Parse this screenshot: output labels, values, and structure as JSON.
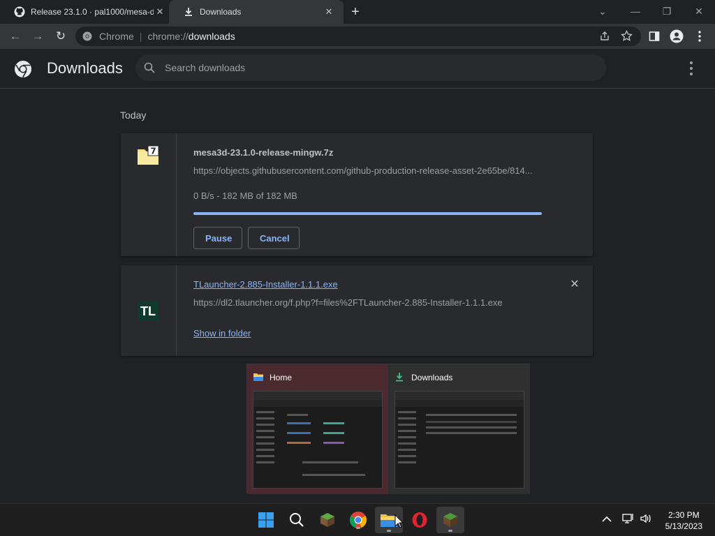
{
  "tabs": [
    {
      "title": "Release 23.1.0 · pal1000/mesa-di",
      "close": "✕"
    },
    {
      "title": "Downloads",
      "close": "✕"
    }
  ],
  "new_tab": "+",
  "window_controls": {
    "minimize": "—",
    "restore": "❐",
    "close": "✕",
    "dropdown": "⌄"
  },
  "toolbar": {
    "back": "←",
    "forward": "→",
    "reload": "↻",
    "site_label": "Chrome",
    "url_scheme": "chrome://",
    "url_host": "downloads"
  },
  "header": {
    "title": "Downloads",
    "search_placeholder": "Search downloads"
  },
  "section_label": "Today",
  "downloads": [
    {
      "filename": "mesa3d-23.1.0-release-mingw.7z",
      "url": "https://objects.githubusercontent.com/github-production-release-asset-2e65be/814...",
      "status": "0 B/s - 182 MB of 182 MB",
      "progress": 1.0,
      "pause_label": "Pause",
      "cancel_label": "Cancel",
      "icon_label": "7"
    },
    {
      "filename": "TLauncher-2.885-Installer-1.1.1.exe",
      "url": "https://dl2.tlauncher.org/f.php?f=files%2FTLauncher-2.885-Installer-1.1.1.exe",
      "show_in_folder": "Show in folder",
      "icon_label": "TL",
      "remove": "✕"
    }
  ],
  "taskbar_preview": [
    {
      "title": "Home"
    },
    {
      "title": "Downloads"
    }
  ],
  "clock": {
    "time": "2:30 PM",
    "date": "5/13/2023"
  },
  "colors": {
    "accent": "#8ab4f8",
    "background": "#202124",
    "card": "#292a2d"
  }
}
